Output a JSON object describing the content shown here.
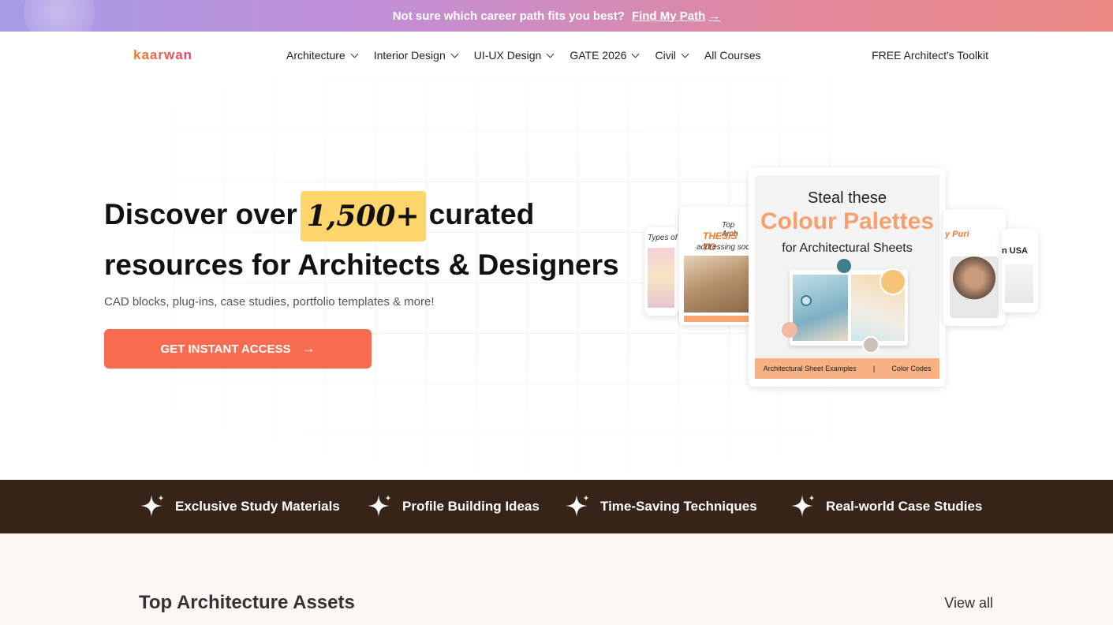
{
  "banner": {
    "text": "Not sure which career path fits you best?",
    "link": "Find My Path",
    "arrow": "→"
  },
  "nav": {
    "logo": "kaarwan",
    "items": [
      {
        "label": "Architecture",
        "dropdown": true
      },
      {
        "label": "Interior Design",
        "dropdown": true
      },
      {
        "label": "UI-UX Design",
        "dropdown": true
      },
      {
        "label": "GATE 2026",
        "dropdown": true
      },
      {
        "label": "Civil",
        "dropdown": true
      },
      {
        "label": "All Courses",
        "dropdown": false
      }
    ],
    "toolkit": "FREE Architect's Toolkit"
  },
  "hero": {
    "title_part1": "Discover over",
    "highlight": "1,500+",
    "title_part2": "curated",
    "title_line2": "resources for Architects & Designers",
    "subtitle": "CAD blocks, plug-ins, case studies, portfolio templates & more!",
    "cta": "GET INSTANT ACCESS",
    "cta_arrow": "→"
  },
  "cards": {
    "main_line1": "Steal these",
    "main_line2": "Colour Palettes",
    "main_line3": "for Architectural Sheets",
    "main_foot1": "Architectural Sheet Examples",
    "main_foot2": "Color Codes",
    "left_title": "Top Arch",
    "left_thesis": "THESIS TO",
    "left_sub": "addressing soci",
    "far_left_title": "Types of",
    "right_title": "y Puri",
    "far_right_title": "n USA"
  },
  "features": [
    {
      "label": "Exclusive Study Materials",
      "icon": "sparkle-icon"
    },
    {
      "label": "Profile Building Ideas",
      "icon": "sparkle-icon"
    },
    {
      "label": "Time-Saving Techniques",
      "icon": "sparkle-icon"
    },
    {
      "label": "Real-world Case Studies",
      "icon": "sparkle-icon"
    }
  ],
  "assets": {
    "title": "Top Architecture Assets",
    "view_all": "View all"
  },
  "colors": {
    "accent": "#f76b50",
    "highlight": "#ffd66b",
    "strip": "#352417"
  }
}
